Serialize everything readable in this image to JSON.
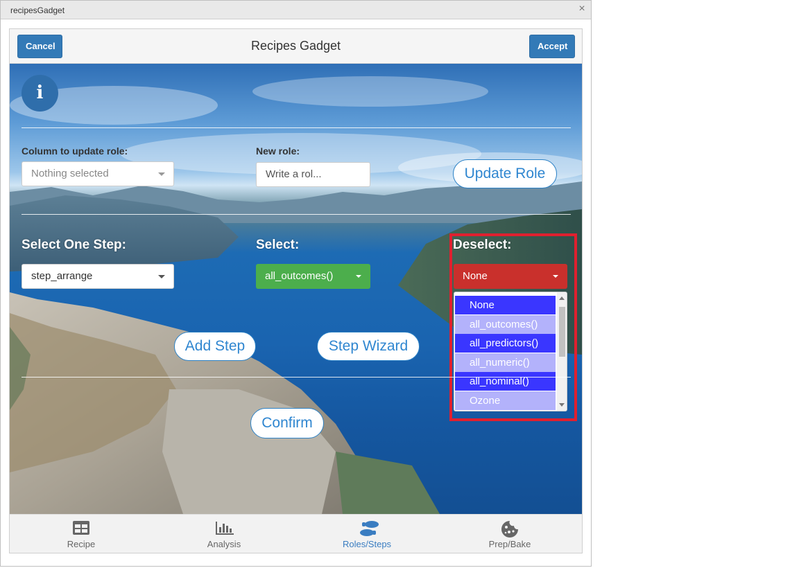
{
  "window": {
    "title": "recipesGadget",
    "close_glyph": "×"
  },
  "header": {
    "title": "Recipes Gadget",
    "cancel_label": "Cancel",
    "accept_label": "Accept"
  },
  "info": {
    "glyph": "i",
    "icon": "info-icon"
  },
  "role_section": {
    "column_label": "Column to update role:",
    "column_value": "Nothing selected",
    "new_role_label": "New role:",
    "new_role_placeholder": "Write a rol...",
    "update_button": "Update Role"
  },
  "step_section": {
    "step_label": "Select One Step:",
    "step_value": "step_arrange",
    "select_label": "Select:",
    "select_value": "all_outcomes()",
    "deselect_label": "Deselect:",
    "deselect_value": "None",
    "deselect_options": [
      "None",
      "all_outcomes()",
      "all_predictors()",
      "all_numeric()",
      "all_nominal()",
      "Ozone"
    ],
    "add_step_button": "Add Step",
    "step_wizard_button": "Step Wizard",
    "confirm_button": "Confirm"
  },
  "tabs": [
    {
      "label": "Recipe",
      "icon": "table-icon",
      "active": false
    },
    {
      "label": "Analysis",
      "icon": "bar-chart-icon",
      "active": false
    },
    {
      "label": "Roles/Steps",
      "icon": "shoe-prints-icon",
      "active": true
    },
    {
      "label": "Prep/Bake",
      "icon": "cookie-icon",
      "active": false
    }
  ],
  "colors": {
    "primary": "#337ab7",
    "select_green": "#4cae4c",
    "deselect_red": "#c9302c",
    "option_dark": "#3a36ff",
    "option_light": "#b3b2fb",
    "highlight_border": "#e0202f",
    "active_tab": "#3a7dc1"
  }
}
